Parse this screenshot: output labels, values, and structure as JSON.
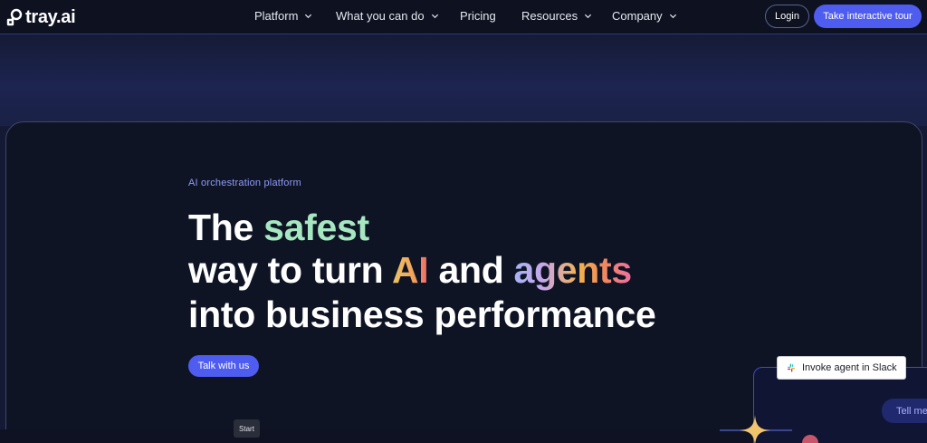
{
  "brand": {
    "name": "tray.ai",
    "icon": "tray-logo-icon"
  },
  "nav": {
    "items": [
      {
        "label": "Platform",
        "has_dropdown": true
      },
      {
        "label": "What you can do",
        "has_dropdown": true
      },
      {
        "label": "Pricing",
        "has_dropdown": false
      },
      {
        "label": "Resources",
        "has_dropdown": true
      },
      {
        "label": "Company",
        "has_dropdown": true
      }
    ],
    "login_label": "Login",
    "tour_label": "Take interactive tour"
  },
  "hero": {
    "eyebrow": "AI orchestration platform",
    "headline": {
      "line1_prefix": "The ",
      "line1_highlight": "safest",
      "line2_prefix": "way to turn ",
      "line2_ai": "AI",
      "line2_mid": " and ",
      "line2_agents": "agents",
      "line3": "into business performance"
    },
    "cta_label": "Talk with us"
  },
  "demo": {
    "slack_chip_label": "Invoke agent in Slack",
    "slack_icon": "slack-icon",
    "tell_chip_label": "Tell me",
    "sparkle_icon": "sparkle-icon"
  },
  "tooltip": {
    "start_label": "Start"
  },
  "colors": {
    "accent": "#4f5cf0",
    "nav_bg": "#0d1120",
    "hero_bg": "#0f1425",
    "safest": "#a6e6c0",
    "eyebrow": "#8e9cf5"
  }
}
